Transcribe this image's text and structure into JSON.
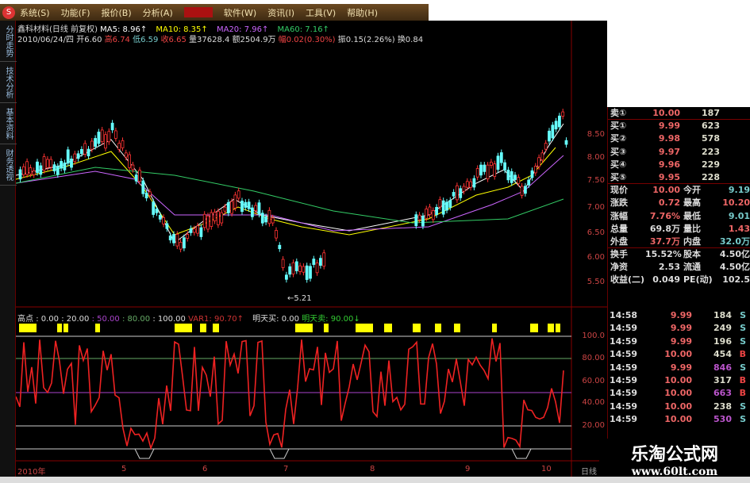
{
  "menu": {
    "logo": "S",
    "items": [
      "系统(S)",
      "功能(F)",
      "报价(B)",
      "分析(A)",
      "",
      "软件(W)",
      "资讯(I)",
      "工具(V)",
      "帮助(H)"
    ]
  },
  "side_tabs": [
    "分时走势",
    "技术分析",
    "基本资料",
    "财务透视"
  ],
  "header": {
    "stock": "鑫科材料(日线 前复权)",
    "ma5": "MA5: 8.96↑",
    "ma10": "MA10: 8.35↑",
    "ma20": "MA20: 7.96↑",
    "ma60": "MA60: 7.16↑",
    "date": "2010/06/24/四",
    "open": "开6.60",
    "high": "高6.74",
    "low": "低6.59",
    "close": "收6.65",
    "volume": "量37628.4",
    "amount": "额2504.9万",
    "change": "幅0.02(0.30%)",
    "amplitude": "振0.15(2.26%)",
    "turnover": "换0.84"
  },
  "colors": {
    "ma5": "#ffffff",
    "ma10": "#ffff00",
    "ma20": "#cc66ff",
    "ma60": "#33cc66",
    "up": "#ff3333",
    "down": "#66ffff"
  },
  "price_axis": [
    "8.50",
    "8.00",
    "7.50",
    "7.00",
    "6.50",
    "6.00",
    "5.50"
  ],
  "low_marker": "5.21",
  "quote": {
    "sell": [
      {
        "label": "卖①",
        "price": "10.00",
        "vol": "187"
      }
    ],
    "buy": [
      {
        "label": "买①",
        "price": "9.99",
        "vol": "623"
      },
      {
        "label": "买②",
        "price": "9.98",
        "vol": "578"
      },
      {
        "label": "买③",
        "price": "9.97",
        "vol": "223"
      },
      {
        "label": "买④",
        "price": "9.96",
        "vol": "229"
      },
      {
        "label": "买⑤",
        "price": "9.95",
        "vol": "228"
      }
    ],
    "stats": [
      {
        "l": "现价",
        "v": "10.00",
        "l2": "今开",
        "v2": "9.19",
        "c2": "#7cc"
      },
      {
        "l": "涨跌",
        "v": "0.72",
        "l2": "最高",
        "v2": "10.20",
        "c2": "#e66"
      },
      {
        "l": "涨幅",
        "v": "7.76%",
        "l2": "最低",
        "v2": "9.01",
        "c2": "#7cc"
      },
      {
        "l": "总量",
        "v": "69.8万",
        "l2": "量比",
        "v2": "1.43",
        "c2": "#e66",
        "c1": "#ddd"
      },
      {
        "l": "外盘",
        "v": "37.7万",
        "l2": "内盘",
        "v2": "32.0万",
        "c2": "#7cc"
      }
    ],
    "fund": [
      {
        "l": "换手",
        "v": "15.52%",
        "l2": "股本",
        "v2": "4.50亿"
      },
      {
        "l": "净资",
        "v": "2.53",
        "l2": "流通",
        "v2": "4.50亿"
      },
      {
        "l": "收益(二)",
        "v": "0.049",
        "l2": "PE(动)",
        "v2": "102.5"
      }
    ]
  },
  "indicator": {
    "name": "高点",
    "v1": ": 0.00",
    "v2": ": 20.00",
    "v3": ": 50.00",
    "v4": ": 80.00",
    "v5": ": 100.00",
    "var1": "VAR1: 90.70↑",
    "buy": "明天买: 0.00",
    "sell": "明天卖: 90.00↓",
    "axis": [
      "100.0",
      "80.00",
      "60.00",
      "40.00",
      "20.00"
    ]
  },
  "trades": [
    {
      "t": "14:58",
      "p": "9.99",
      "v": "184",
      "bs": "S",
      "vc": "#ddc"
    },
    {
      "t": "14:59",
      "p": "9.99",
      "v": "249",
      "bs": "S",
      "vc": "#ddc"
    },
    {
      "t": "14:59",
      "p": "9.99",
      "v": "196",
      "bs": "S",
      "vc": "#ddc"
    },
    {
      "t": "14:59",
      "p": "10.00",
      "v": "454",
      "bs": "B",
      "vc": "#ddc"
    },
    {
      "t": "14:59",
      "p": "9.99",
      "v": "846",
      "bs": "S",
      "vc": "#b5c"
    },
    {
      "t": "14:59",
      "p": "10.00",
      "v": "317",
      "bs": "B",
      "vc": "#ddc"
    },
    {
      "t": "14:59",
      "p": "10.00",
      "v": "663",
      "bs": "B",
      "vc": "#b5c"
    },
    {
      "t": "14:59",
      "p": "10.00",
      "v": "238",
      "bs": "S",
      "vc": "#ddc"
    },
    {
      "t": "14:59",
      "p": "10.00",
      "v": "530",
      "bs": "S",
      "vc": "#b5c"
    }
  ],
  "x_axis": [
    "2010年",
    "5",
    "6",
    "7",
    "8",
    "9",
    "10"
  ],
  "period": "日线",
  "watermark": {
    "name": "乐淘公式网",
    "url": "www.60lt.com"
  }
}
